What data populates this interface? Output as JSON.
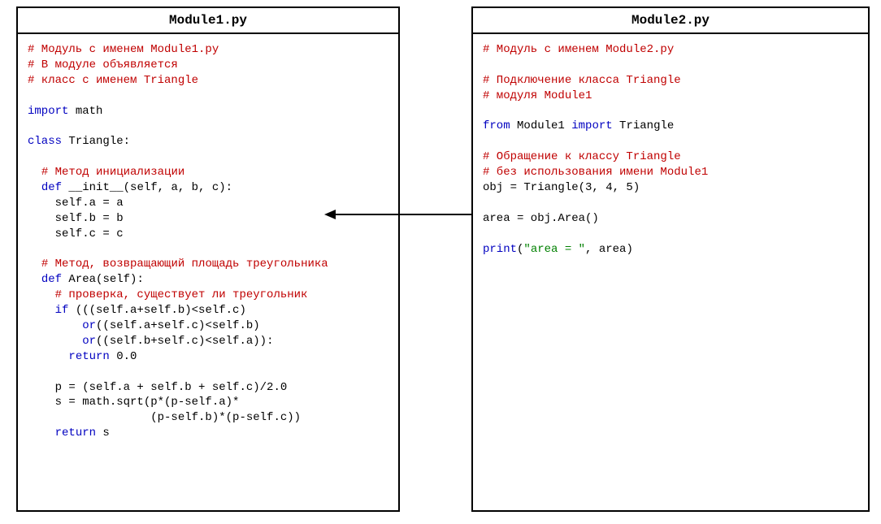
{
  "module1": {
    "title": "Module1.py",
    "lines": [
      [
        {
          "cls": "comment",
          "t": "# Модуль с именем Module1.py"
        }
      ],
      [
        {
          "cls": "comment",
          "t": "# В модуле объявляется"
        }
      ],
      [
        {
          "cls": "comment",
          "t": "# класс с именем Triangle"
        }
      ],
      [
        {
          "cls": "plain",
          "t": ""
        }
      ],
      [
        {
          "cls": "keyword",
          "t": "import"
        },
        {
          "cls": "plain",
          "t": " math"
        }
      ],
      [
        {
          "cls": "plain",
          "t": ""
        }
      ],
      [
        {
          "cls": "keyword",
          "t": "class"
        },
        {
          "cls": "plain",
          "t": " Triangle:"
        }
      ],
      [
        {
          "cls": "plain",
          "t": ""
        }
      ],
      [
        {
          "cls": "plain",
          "t": "  "
        },
        {
          "cls": "comment",
          "t": "# Метод инициализации"
        }
      ],
      [
        {
          "cls": "plain",
          "t": "  "
        },
        {
          "cls": "keyword",
          "t": "def"
        },
        {
          "cls": "plain",
          "t": " __init__(self, a, b, c):"
        }
      ],
      [
        {
          "cls": "plain",
          "t": "    self.a = a"
        }
      ],
      [
        {
          "cls": "plain",
          "t": "    self.b = b"
        }
      ],
      [
        {
          "cls": "plain",
          "t": "    self.c = c"
        }
      ],
      [
        {
          "cls": "plain",
          "t": ""
        }
      ],
      [
        {
          "cls": "plain",
          "t": "  "
        },
        {
          "cls": "comment",
          "t": "# Метод, возвращающий площадь треугольника"
        }
      ],
      [
        {
          "cls": "plain",
          "t": "  "
        },
        {
          "cls": "keyword",
          "t": "def"
        },
        {
          "cls": "plain",
          "t": " Area(self):"
        }
      ],
      [
        {
          "cls": "plain",
          "t": "    "
        },
        {
          "cls": "comment",
          "t": "# проверка, существует ли треугольник"
        }
      ],
      [
        {
          "cls": "plain",
          "t": "    "
        },
        {
          "cls": "keyword",
          "t": "if"
        },
        {
          "cls": "plain",
          "t": " (((self.a+self.b)<self.c)"
        }
      ],
      [
        {
          "cls": "plain",
          "t": "        "
        },
        {
          "cls": "keyword",
          "t": "or"
        },
        {
          "cls": "plain",
          "t": "((self.a+self.c)<self.b)"
        }
      ],
      [
        {
          "cls": "plain",
          "t": "        "
        },
        {
          "cls": "keyword",
          "t": "or"
        },
        {
          "cls": "plain",
          "t": "((self.b+self.c)<self.a)):"
        }
      ],
      [
        {
          "cls": "plain",
          "t": "      "
        },
        {
          "cls": "keyword",
          "t": "return"
        },
        {
          "cls": "plain",
          "t": " 0.0"
        }
      ],
      [
        {
          "cls": "plain",
          "t": ""
        }
      ],
      [
        {
          "cls": "plain",
          "t": "    p = (self.a + self.b + self.c)/2.0"
        }
      ],
      [
        {
          "cls": "plain",
          "t": "    s = math.sqrt(p*(p-self.a)*"
        }
      ],
      [
        {
          "cls": "plain",
          "t": "                  (p-self.b)*(p-self.c))"
        }
      ],
      [
        {
          "cls": "plain",
          "t": "    "
        },
        {
          "cls": "keyword",
          "t": "return"
        },
        {
          "cls": "plain",
          "t": " s"
        }
      ]
    ]
  },
  "module2": {
    "title": "Module2.py",
    "lines": [
      [
        {
          "cls": "comment",
          "t": "# Модуль с именем Module2.py"
        }
      ],
      [
        {
          "cls": "plain",
          "t": ""
        }
      ],
      [
        {
          "cls": "comment",
          "t": "# Подключение класса Triangle"
        }
      ],
      [
        {
          "cls": "comment",
          "t": "# модуля Module1"
        }
      ],
      [
        {
          "cls": "plain",
          "t": ""
        }
      ],
      [
        {
          "cls": "keyword",
          "t": "from"
        },
        {
          "cls": "plain",
          "t": " Module1 "
        },
        {
          "cls": "keyword",
          "t": "import"
        },
        {
          "cls": "plain",
          "t": " Triangle"
        }
      ],
      [
        {
          "cls": "plain",
          "t": ""
        }
      ],
      [
        {
          "cls": "comment",
          "t": "# Обращение к классу Triangle"
        }
      ],
      [
        {
          "cls": "comment",
          "t": "# без использования имени Module1"
        }
      ],
      [
        {
          "cls": "plain",
          "t": "obj = Triangle(3, 4, 5)"
        }
      ],
      [
        {
          "cls": "plain",
          "t": ""
        }
      ],
      [
        {
          "cls": "plain",
          "t": "area = obj.Area()"
        }
      ],
      [
        {
          "cls": "plain",
          "t": ""
        }
      ],
      [
        {
          "cls": "keyword",
          "t": "print"
        },
        {
          "cls": "plain",
          "t": "("
        },
        {
          "cls": "string",
          "t": "\"area = \""
        },
        {
          "cls": "plain",
          "t": ", area)"
        }
      ]
    ]
  }
}
